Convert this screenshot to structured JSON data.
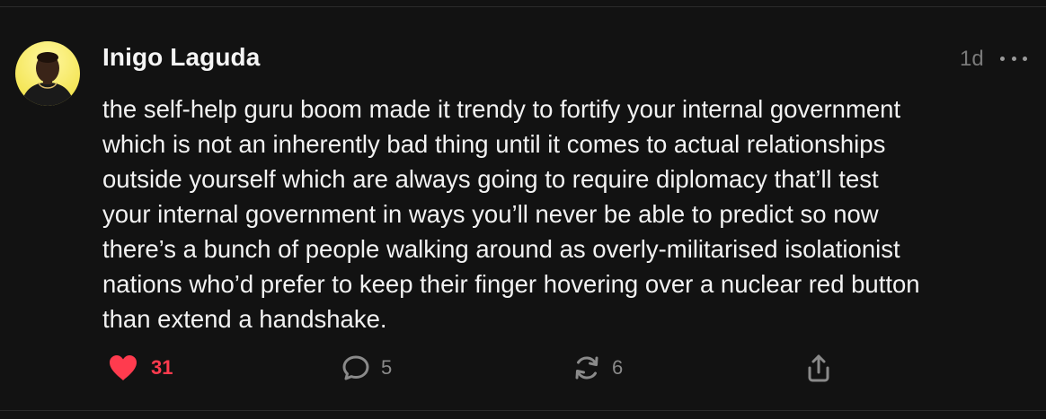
{
  "post": {
    "author": "Inigo Laguda",
    "time": "1d",
    "text": "the self-help guru boom made it trendy to fortify your internal government\nwhich is not an inherently bad thing until it comes to actual relationships\noutside yourself which are always going to require diplomacy that’ll test\nyour internal government in ways you’ll never be able to predict so now\nthere’s a bunch of people walking around as overly-militarised isolationist\nnations who’d prefer to keep their finger hovering over a nuclear red button\nthan extend a handshake.",
    "likes": "31",
    "replies": "5",
    "reposts": "6",
    "liked": true
  },
  "icons": {
    "like": "heart-icon",
    "reply": "speech-bubble-icon",
    "repost": "repost-icon",
    "share": "share-icon",
    "more": "more-dots-icon"
  },
  "colors": {
    "background": "#121212",
    "text": "#f2f2f2",
    "muted": "#8a8a8a",
    "like": "#ff3b4e"
  }
}
